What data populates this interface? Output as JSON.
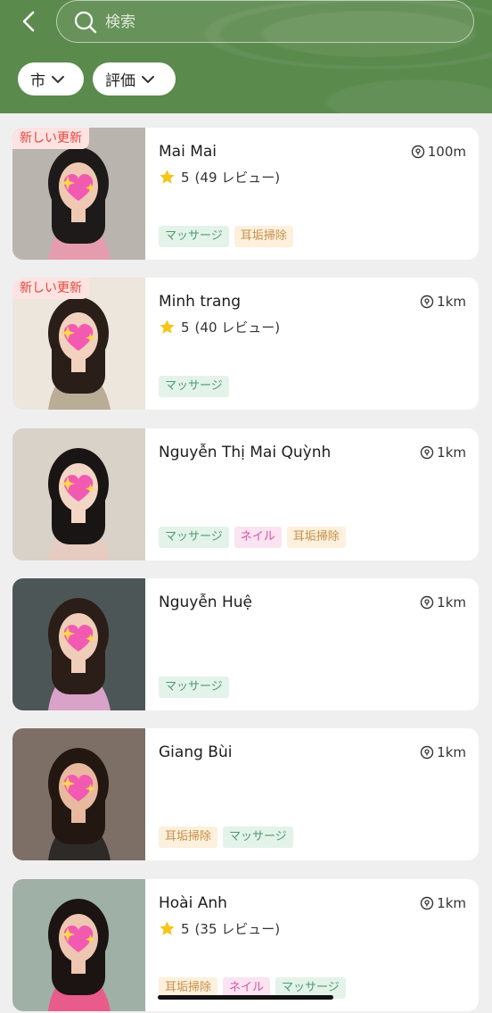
{
  "search": {
    "placeholder": "検索"
  },
  "filters": {
    "city": "市",
    "rating": "評価"
  },
  "labels": {
    "new_badge": "新しい更新"
  },
  "colors": {
    "header_green": "#5b8a4d",
    "star": "#f5c518",
    "badge_red": "#e5473e"
  },
  "cards": [
    {
      "name": "Mai Mai",
      "distance": "100m",
      "new": true,
      "score": "5",
      "reviews": "(49 レビュー)",
      "tags": [
        {
          "text": "マッサージ",
          "kind": "massage"
        },
        {
          "text": "耳垢掃除",
          "kind": "ear"
        }
      ]
    },
    {
      "name": "Minh trang",
      "distance": "1km",
      "new": true,
      "score": "5",
      "reviews": "(40 レビュー)",
      "tags": [
        {
          "text": "マッサージ",
          "kind": "massage"
        }
      ]
    },
    {
      "name": "Nguyễn Thị Mai Quỳnh",
      "distance": "1km",
      "new": false,
      "score": "",
      "reviews": "",
      "tags": [
        {
          "text": "マッサージ",
          "kind": "massage"
        },
        {
          "text": "ネイル",
          "kind": "nail"
        },
        {
          "text": "耳垢掃除",
          "kind": "ear"
        }
      ]
    },
    {
      "name": "Nguyễn Huệ",
      "distance": "1km",
      "new": false,
      "score": "",
      "reviews": "",
      "tags": [
        {
          "text": "マッサージ",
          "kind": "massage"
        }
      ]
    },
    {
      "name": "Giang Bùi",
      "distance": "1km",
      "new": false,
      "score": "",
      "reviews": "",
      "tags": [
        {
          "text": "耳垢掃除",
          "kind": "ear"
        },
        {
          "text": "マッサージ",
          "kind": "massage"
        }
      ]
    },
    {
      "name": "Hoài Anh",
      "distance": "1km",
      "new": false,
      "score": "5",
      "reviews": "(35 レビュー)",
      "tags": [
        {
          "text": "耳垢掃除",
          "kind": "ear"
        },
        {
          "text": "ネイル",
          "kind": "nail"
        },
        {
          "text": "マッサージ",
          "kind": "massage"
        }
      ]
    }
  ]
}
